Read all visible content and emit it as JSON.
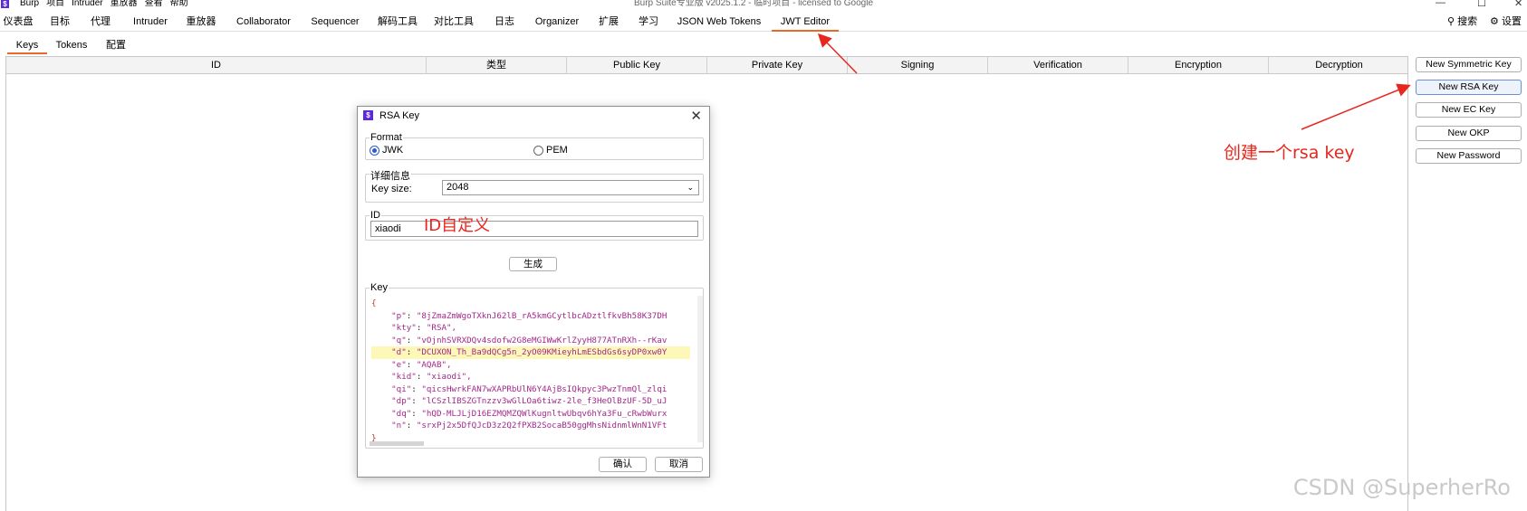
{
  "window": {
    "title": "Burp Suite专业版  v2025.1.2 - 临时项目 - licensed to Google",
    "logo": "$",
    "menu": [
      "Burp",
      "项目",
      "Intruder",
      "重放器",
      "查看",
      "帮助"
    ],
    "controls": [
      "—",
      "☐",
      "✕"
    ]
  },
  "tabs": [
    "仪表盘",
    "目标",
    "代理",
    "Intruder",
    "重放器",
    "Collaborator",
    "Sequencer",
    "解码工具",
    "对比工具",
    "日志",
    "Organizer",
    "扩展",
    "学习",
    "JSON Web Tokens",
    "JWT Editor"
  ],
  "active_tab": "JWT Editor",
  "search_label": "搜索",
  "settings_label": "设置",
  "subtabs": [
    "Keys",
    "Tokens",
    "配置"
  ],
  "active_subtab": "Keys",
  "table_headers": [
    "ID",
    "类型",
    "Public Key",
    "Private Key",
    "Signing",
    "Verification",
    "Encryption",
    "Decryption"
  ],
  "side_buttons": [
    "New Symmetric Key",
    "New RSA Key",
    "New EC Key",
    "New OKP",
    "New Password"
  ],
  "annotations": {
    "rsa_note": "创建一个rsa key",
    "id_note": "ID自定义"
  },
  "watermark": "CSDN @SuperherRo",
  "dialog": {
    "title": "RSA Key",
    "format_legend": "Format",
    "format_options": [
      "JWK",
      "PEM"
    ],
    "format_selected": "JWK",
    "details_legend": "详细信息",
    "key_size_label": "Key size:",
    "key_size_value": "2048",
    "id_legend": "ID",
    "id_value": "xiaodi",
    "generate_label": "生成",
    "key_legend": "Key",
    "key_lines": [
      {
        "text": "{",
        "kind": "brace"
      },
      {
        "key": "\"p\"",
        "val": "\"8jZmaZmWgoTXknJ62lB_rA5kmGCytlbcADztlfkvBh58K37DH",
        "kind": "pair"
      },
      {
        "key": "\"kty\"",
        "val": "\"RSA\",",
        "kind": "pair"
      },
      {
        "key": "\"q\"",
        "val": "\"vOjnhSVRXDQv4sdofw2G8eMGIWwKrlZyyH877ATnRXh--rKav",
        "kind": "pair"
      },
      {
        "key": "\"d\"",
        "val": "\"DCUXON_Th_Ba9dQCg5n_2yO09KMieyhLmESbdGs6syDP0xw0Y",
        "kind": "pair",
        "hl": true
      },
      {
        "key": "\"e\"",
        "val": "\"AQAB\",",
        "kind": "pair"
      },
      {
        "key": "\"kid\"",
        "val": "\"xiaodi\",",
        "kind": "pair"
      },
      {
        "key": "\"qi\"",
        "val": "\"qicsHwrkFAN7wXAPRbUlN6Y4AjBsIQkpyc3PwzTnmQl_zlqi",
        "kind": "pair"
      },
      {
        "key": "\"dp\"",
        "val": "\"lCSzlIBSZGTnzzv3wGlLOa6tiwz-2le_f3HeOlBzUF-5D_uJ",
        "kind": "pair"
      },
      {
        "key": "\"dq\"",
        "val": "\"hQD-MLJLjD16EZMQMZQWlKugnltwUbqv6hYa3Fu_cRwbWurx",
        "kind": "pair"
      },
      {
        "key": "\"n\"",
        "val": "\"srxPj2x5DfQJcD3z2Q2fPXB2SocaB50ggMhsNidnmlWnN1VFt",
        "kind": "pair"
      },
      {
        "text": "}",
        "kind": "brace"
      }
    ],
    "ok_label": "确认",
    "cancel_label": "取消"
  }
}
